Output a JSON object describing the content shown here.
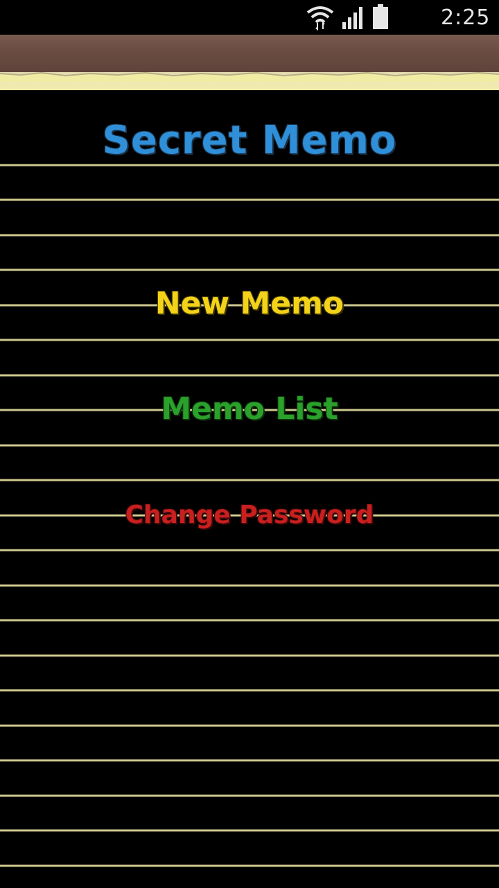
{
  "status_bar": {
    "time": "2:25",
    "icons": [
      "wifi-icon",
      "signal-icon",
      "battery-icon"
    ]
  },
  "app": {
    "title": "Secret Memo"
  },
  "menu": {
    "new_memo": "New Memo",
    "memo_list": "Memo List",
    "change_password": "Change Password"
  },
  "colors": {
    "title": "#2f8fd8",
    "new_memo": "#f3d21a",
    "memo_list": "#2aa12a",
    "change_password": "#c81f1f",
    "paper": "#f1eca4",
    "binding": "#6a4c43"
  }
}
